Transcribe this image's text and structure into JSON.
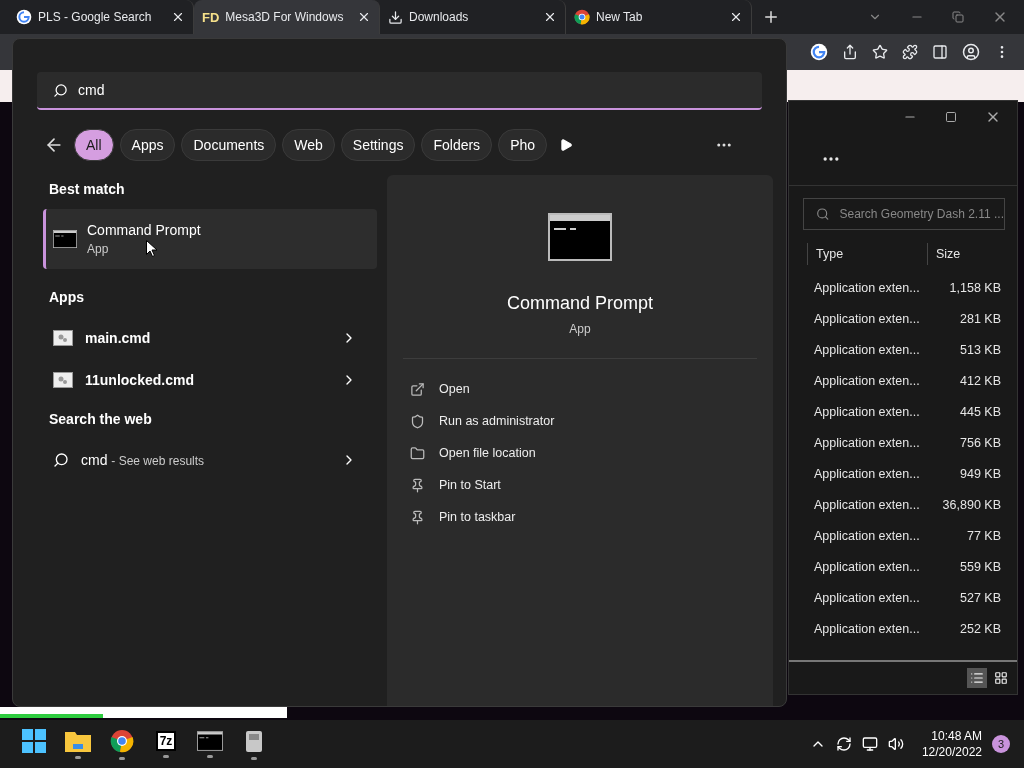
{
  "browser": {
    "tabs": [
      {
        "title": "PLS - Google Search",
        "kind": "google",
        "selected": false
      },
      {
        "title": "Mesa3D For Windows",
        "kind": "text",
        "icon_text": "FD",
        "selected": true
      },
      {
        "title": "Downloads",
        "kind": "download",
        "selected": false
      },
      {
        "title": "New Tab",
        "kind": "chrome",
        "selected": false
      }
    ]
  },
  "download_bar": {
    "level": 0.36
  },
  "explorer": {
    "search": {
      "placeholder": "Search Geometry Dash 2.11 ..."
    },
    "columns": [
      "Type",
      "Size"
    ],
    "rows": [
      {
        "type": "Application exten...",
        "size": "1,158 KB"
      },
      {
        "type": "Application exten...",
        "size": "281 KB"
      },
      {
        "type": "Application exten...",
        "size": "513 KB"
      },
      {
        "type": "Application exten...",
        "size": "412 KB"
      },
      {
        "type": "Application exten...",
        "size": "445 KB"
      },
      {
        "type": "Application exten...",
        "size": "756 KB"
      },
      {
        "type": "Application exten...",
        "size": "949 KB"
      },
      {
        "type": "Application exten...",
        "size": "36,890 KB"
      },
      {
        "type": "Application exten...",
        "size": "77 KB"
      },
      {
        "type": "Application exten...",
        "size": "559 KB"
      },
      {
        "type": "Application exten...",
        "size": "527 KB"
      },
      {
        "type": "Application exten...",
        "size": "252 KB"
      }
    ]
  },
  "start_search": {
    "query": "cmd",
    "filters": [
      {
        "label": "All",
        "selected": true
      },
      {
        "label": "Apps",
        "selected": false
      },
      {
        "label": "Documents",
        "selected": false
      },
      {
        "label": "Web",
        "selected": false
      },
      {
        "label": "Settings",
        "selected": false
      },
      {
        "label": "Folders",
        "selected": false
      },
      {
        "label": "Pho",
        "selected": false
      }
    ],
    "best_match": {
      "heading": "Best match",
      "title": "Command Prompt",
      "subtitle": "App",
      "selected": true
    },
    "apps": {
      "heading": "Apps",
      "items": [
        "main.cmd",
        "11unlocked.cmd"
      ]
    },
    "web": {
      "heading": "Search the web",
      "query": "cmd",
      "suffix": "- See web results"
    },
    "preview": {
      "title": "Command Prompt",
      "subtitle": "App",
      "actions": [
        {
          "label": "Open",
          "kind": "open"
        },
        {
          "label": "Run as administrator",
          "kind": "admin"
        },
        {
          "label": "Open file location",
          "kind": "folder"
        },
        {
          "label": "Pin to Start",
          "kind": "pin"
        },
        {
          "label": "Pin to taskbar",
          "kind": "pin"
        }
      ]
    }
  },
  "taskbar": {
    "apps": [
      {
        "kind": "windows",
        "running": false
      },
      {
        "kind": "folder",
        "running": true
      },
      {
        "kind": "chrome",
        "running": true
      },
      {
        "kind": "text",
        "icon_text": "7z",
        "running": true
      },
      {
        "kind": "terminal",
        "running": true
      },
      {
        "kind": "tool",
        "running": true
      }
    ],
    "clock": {
      "time": "10:48 AM",
      "date": "12/20/2022"
    },
    "notifications": "3"
  }
}
